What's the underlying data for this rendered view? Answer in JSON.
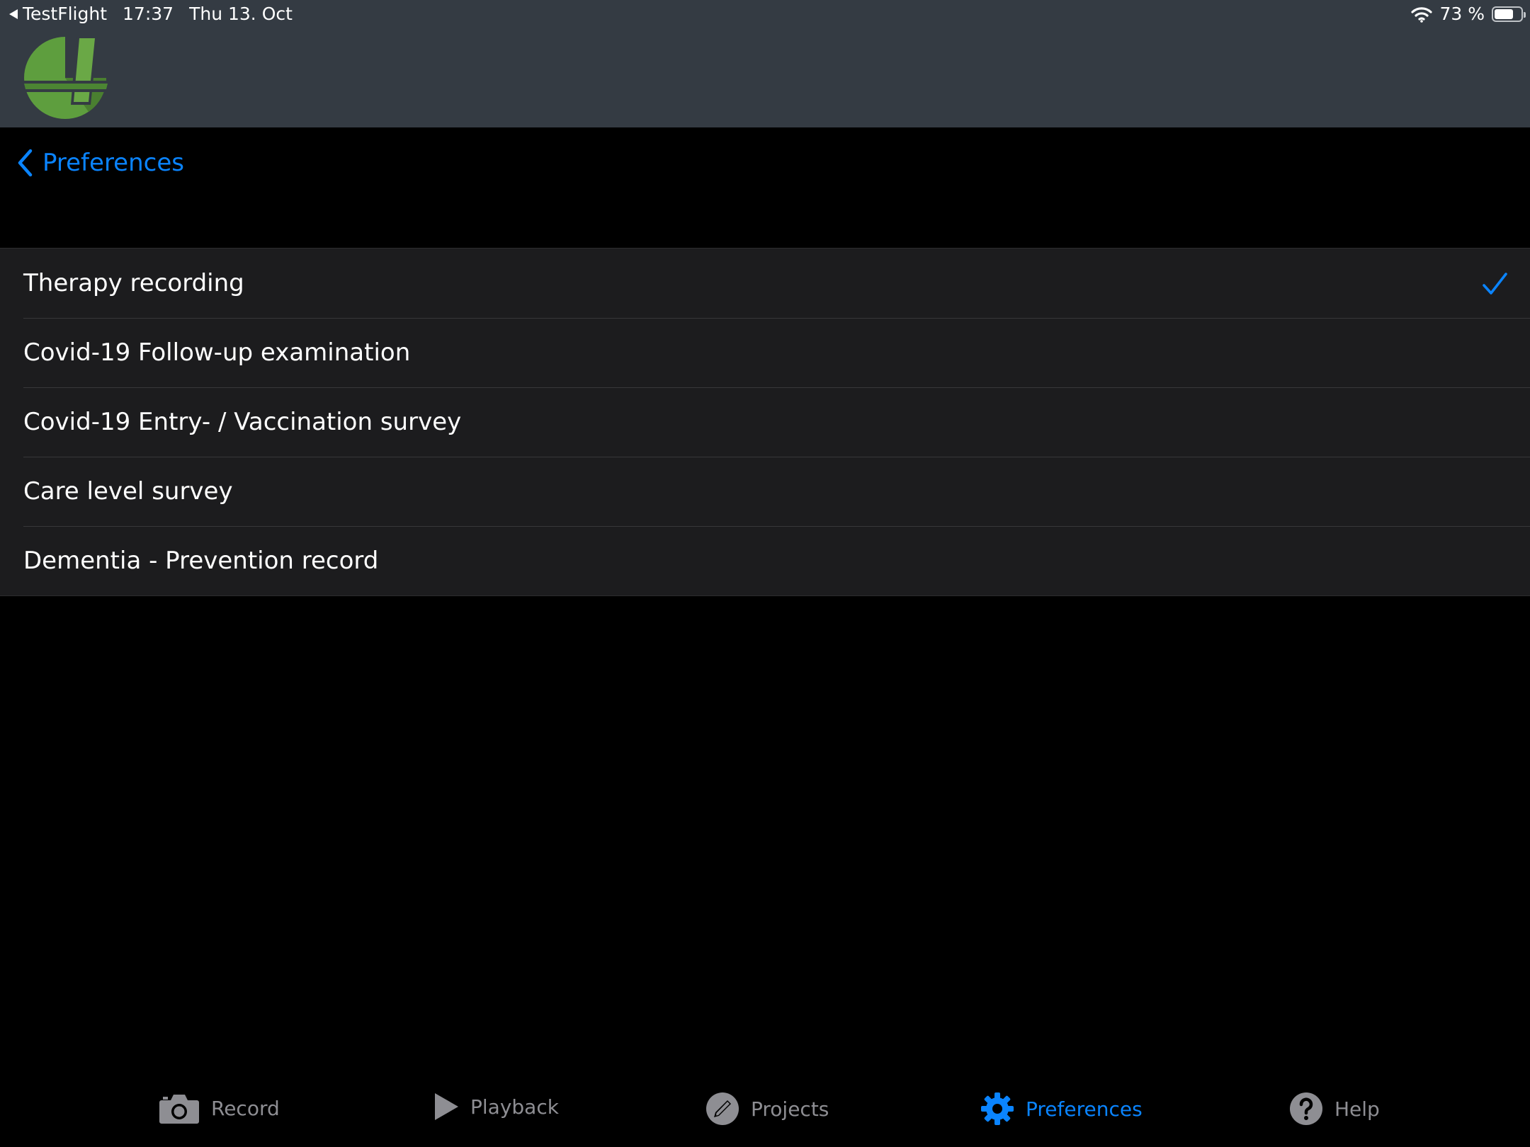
{
  "status_bar": {
    "back_app": "TestFlight",
    "time": "17:37",
    "date": "Thu 13. Oct",
    "battery": "73 %",
    "battery_level": 0.73
  },
  "nav": {
    "back_label": "Preferences"
  },
  "list": {
    "items": [
      {
        "label": "Therapy recording",
        "selected": true
      },
      {
        "label": "Covid-19 Follow-up examination",
        "selected": false
      },
      {
        "label": "Covid-19 Entry- / Vaccination survey",
        "selected": false
      },
      {
        "label": "Care level survey",
        "selected": false
      },
      {
        "label": "Dementia - Prevention record",
        "selected": false
      }
    ]
  },
  "tabbar": {
    "tabs": [
      {
        "label": "Record",
        "icon": "camera-icon",
        "active": false
      },
      {
        "label": "Playback",
        "icon": "play-icon",
        "active": false
      },
      {
        "label": "Projects",
        "icon": "pencil-icon",
        "active": false
      },
      {
        "label": "Preferences",
        "icon": "gear-icon",
        "active": true
      },
      {
        "label": "Help",
        "icon": "help-icon",
        "active": false
      }
    ]
  },
  "colors": {
    "accent": "#0a84ff",
    "header_bg": "#343b43",
    "list_bg": "#1c1c1e",
    "inactive": "#8e8e93",
    "logo_green": "#5e9e3e"
  }
}
